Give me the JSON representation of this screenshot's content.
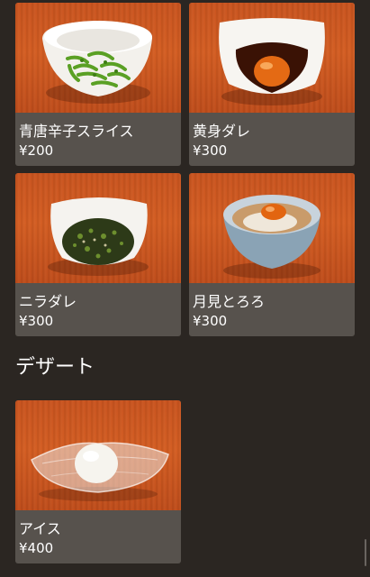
{
  "items": [
    {
      "name": "青唐辛子スライス",
      "price": "¥200",
      "photo": "sliced-green-chili-bowl-photo"
    },
    {
      "name": "黄身ダレ",
      "price": "¥300",
      "photo": "egg-yolk-sauce-bowl-photo"
    },
    {
      "name": "ニラダレ",
      "price": "¥300",
      "photo": "chive-sauce-bowl-photo"
    },
    {
      "name": "月見とろろ",
      "price": "¥300",
      "photo": "tsukimi-tororo-bowl-photo"
    }
  ],
  "dessert_section": {
    "title": "デザート",
    "items": [
      {
        "name": "アイス",
        "price": "¥400",
        "photo": "ice-cream-glass-dish-photo"
      }
    ]
  },
  "colors": {
    "background": "#2b2622",
    "card": "#57524d",
    "text": "#ffffff",
    "wood": "#d35d22"
  }
}
